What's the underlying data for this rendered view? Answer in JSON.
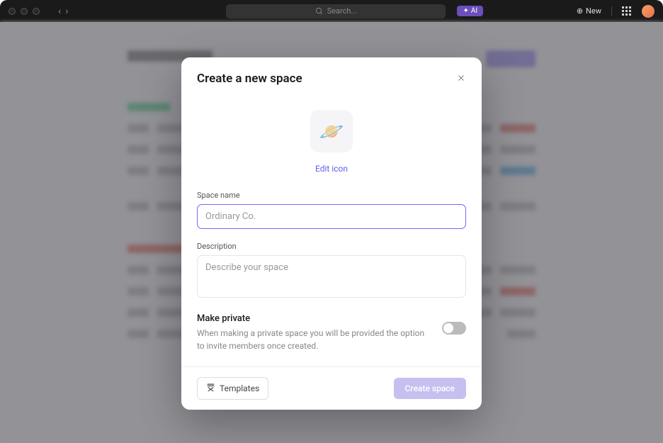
{
  "header": {
    "search_placeholder": "Search...",
    "ai_label": "AI",
    "new_label": "New"
  },
  "modal": {
    "title": "Create a new space",
    "icon_emoji": "🪐",
    "edit_icon_label": "Edit icon",
    "space_name": {
      "label": "Space name",
      "placeholder": "Ordinary Co.",
      "value": ""
    },
    "description": {
      "label": "Description",
      "placeholder": "Describe your space",
      "value": ""
    },
    "privacy": {
      "title": "Make private",
      "description": "When making a private space you will be provided the option to invite members once created."
    },
    "footer": {
      "templates_label": "Templates",
      "create_label": "Create space"
    }
  }
}
